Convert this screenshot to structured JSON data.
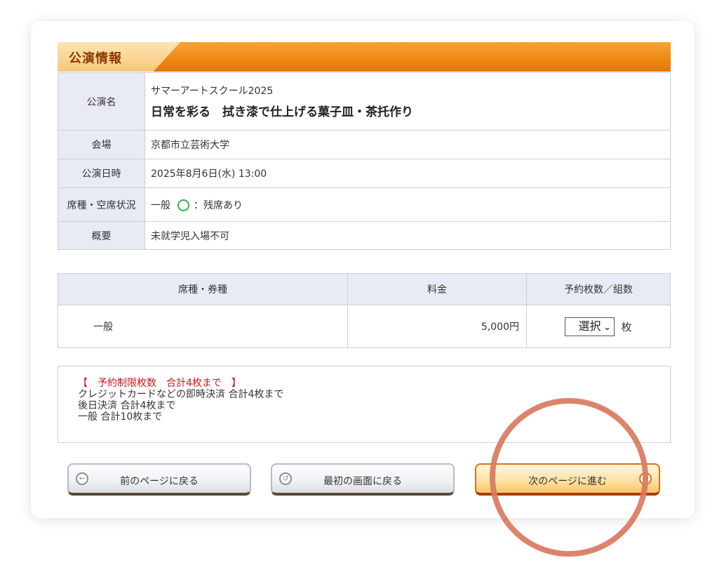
{
  "section": {
    "title": "公演情報"
  },
  "info": {
    "name_label": "公演名",
    "name_sub": "サマーアートスクール2025",
    "name_main": "日常を彩る　拭き漆で仕上げる菓子皿・茶托作り",
    "venue_label": "会場",
    "venue": "京都市立芸術大学",
    "date_label": "公演日時",
    "date": "2025年8月6日(水) 13:00",
    "seat_label": "席種・空席状況",
    "seat_type": "一般",
    "seat_status": "：残席あり",
    "note_label": "概要",
    "note": "未就学児入場不可"
  },
  "price_table": {
    "headers": [
      "席種・券種",
      "料金",
      "予約枚数／組数"
    ],
    "row": {
      "type": "一般",
      "fee": "5,000円",
      "select_value": "選択",
      "unit": "枚"
    }
  },
  "notice": {
    "limit": "【　予約制限枚数　合計4枚まで　】",
    "lines": [
      "クレジットカードなどの即時決済 合計4枚まで",
      "後日決済 合計4枚まで",
      "一般 合計10枚まで"
    ]
  },
  "buttons": {
    "back": "前のページに戻る",
    "first": "最初の画面に戻る",
    "next": "次のページに進む"
  },
  "colors": {
    "header_orange": "#ee8a14",
    "label_bg": "#e9ebf4",
    "limit_red": "#d1141c",
    "ring": "#d97a5e"
  }
}
